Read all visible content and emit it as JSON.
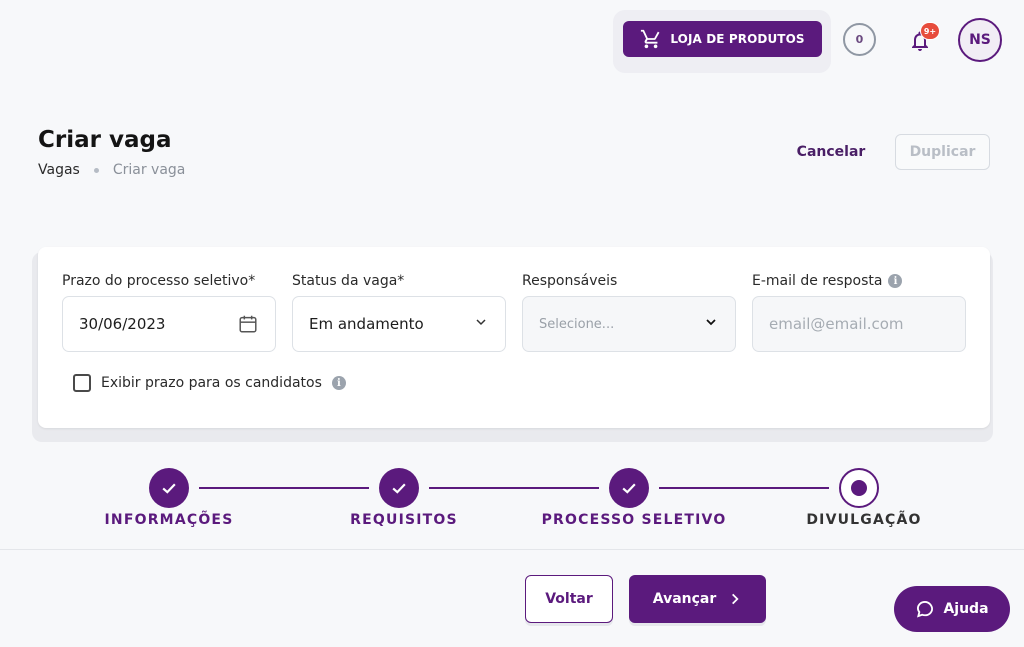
{
  "header": {
    "shop_label": "LOJA DE PRODUTOS",
    "counter": "0",
    "notification_badge": "9+",
    "avatar_initials": "NS"
  },
  "page": {
    "title": "Criar vaga",
    "breadcrumb": [
      "Vagas",
      "Criar vaga"
    ],
    "cancel_label": "Cancelar",
    "duplicate_label": "Duplicar"
  },
  "form": {
    "deadline": {
      "label": "Prazo do processo seletivo*",
      "value": "30/06/2023"
    },
    "status": {
      "label": "Status da vaga*",
      "value": "Em andamento"
    },
    "owners": {
      "label": "Responsáveis",
      "placeholder": "Selecione..."
    },
    "email": {
      "label": "E-mail de resposta",
      "placeholder": "email@email.com"
    },
    "show_deadline_label": "Exibir prazo para os candidatos",
    "show_deadline_checked": false
  },
  "stepper": {
    "steps": [
      {
        "label": "INFORMAÇÕES",
        "state": "done"
      },
      {
        "label": "REQUISITOS",
        "state": "done"
      },
      {
        "label": "PROCESSO SELETIVO",
        "state": "done"
      },
      {
        "label": "DIVULGAÇÃO",
        "state": "current"
      }
    ]
  },
  "footer": {
    "back_label": "Voltar",
    "next_label": "Avançar",
    "help_label": "Ajuda"
  },
  "colors": {
    "primary": "#5b1a7d",
    "badge": "#e74c3c",
    "background": "#f7f8fa"
  }
}
